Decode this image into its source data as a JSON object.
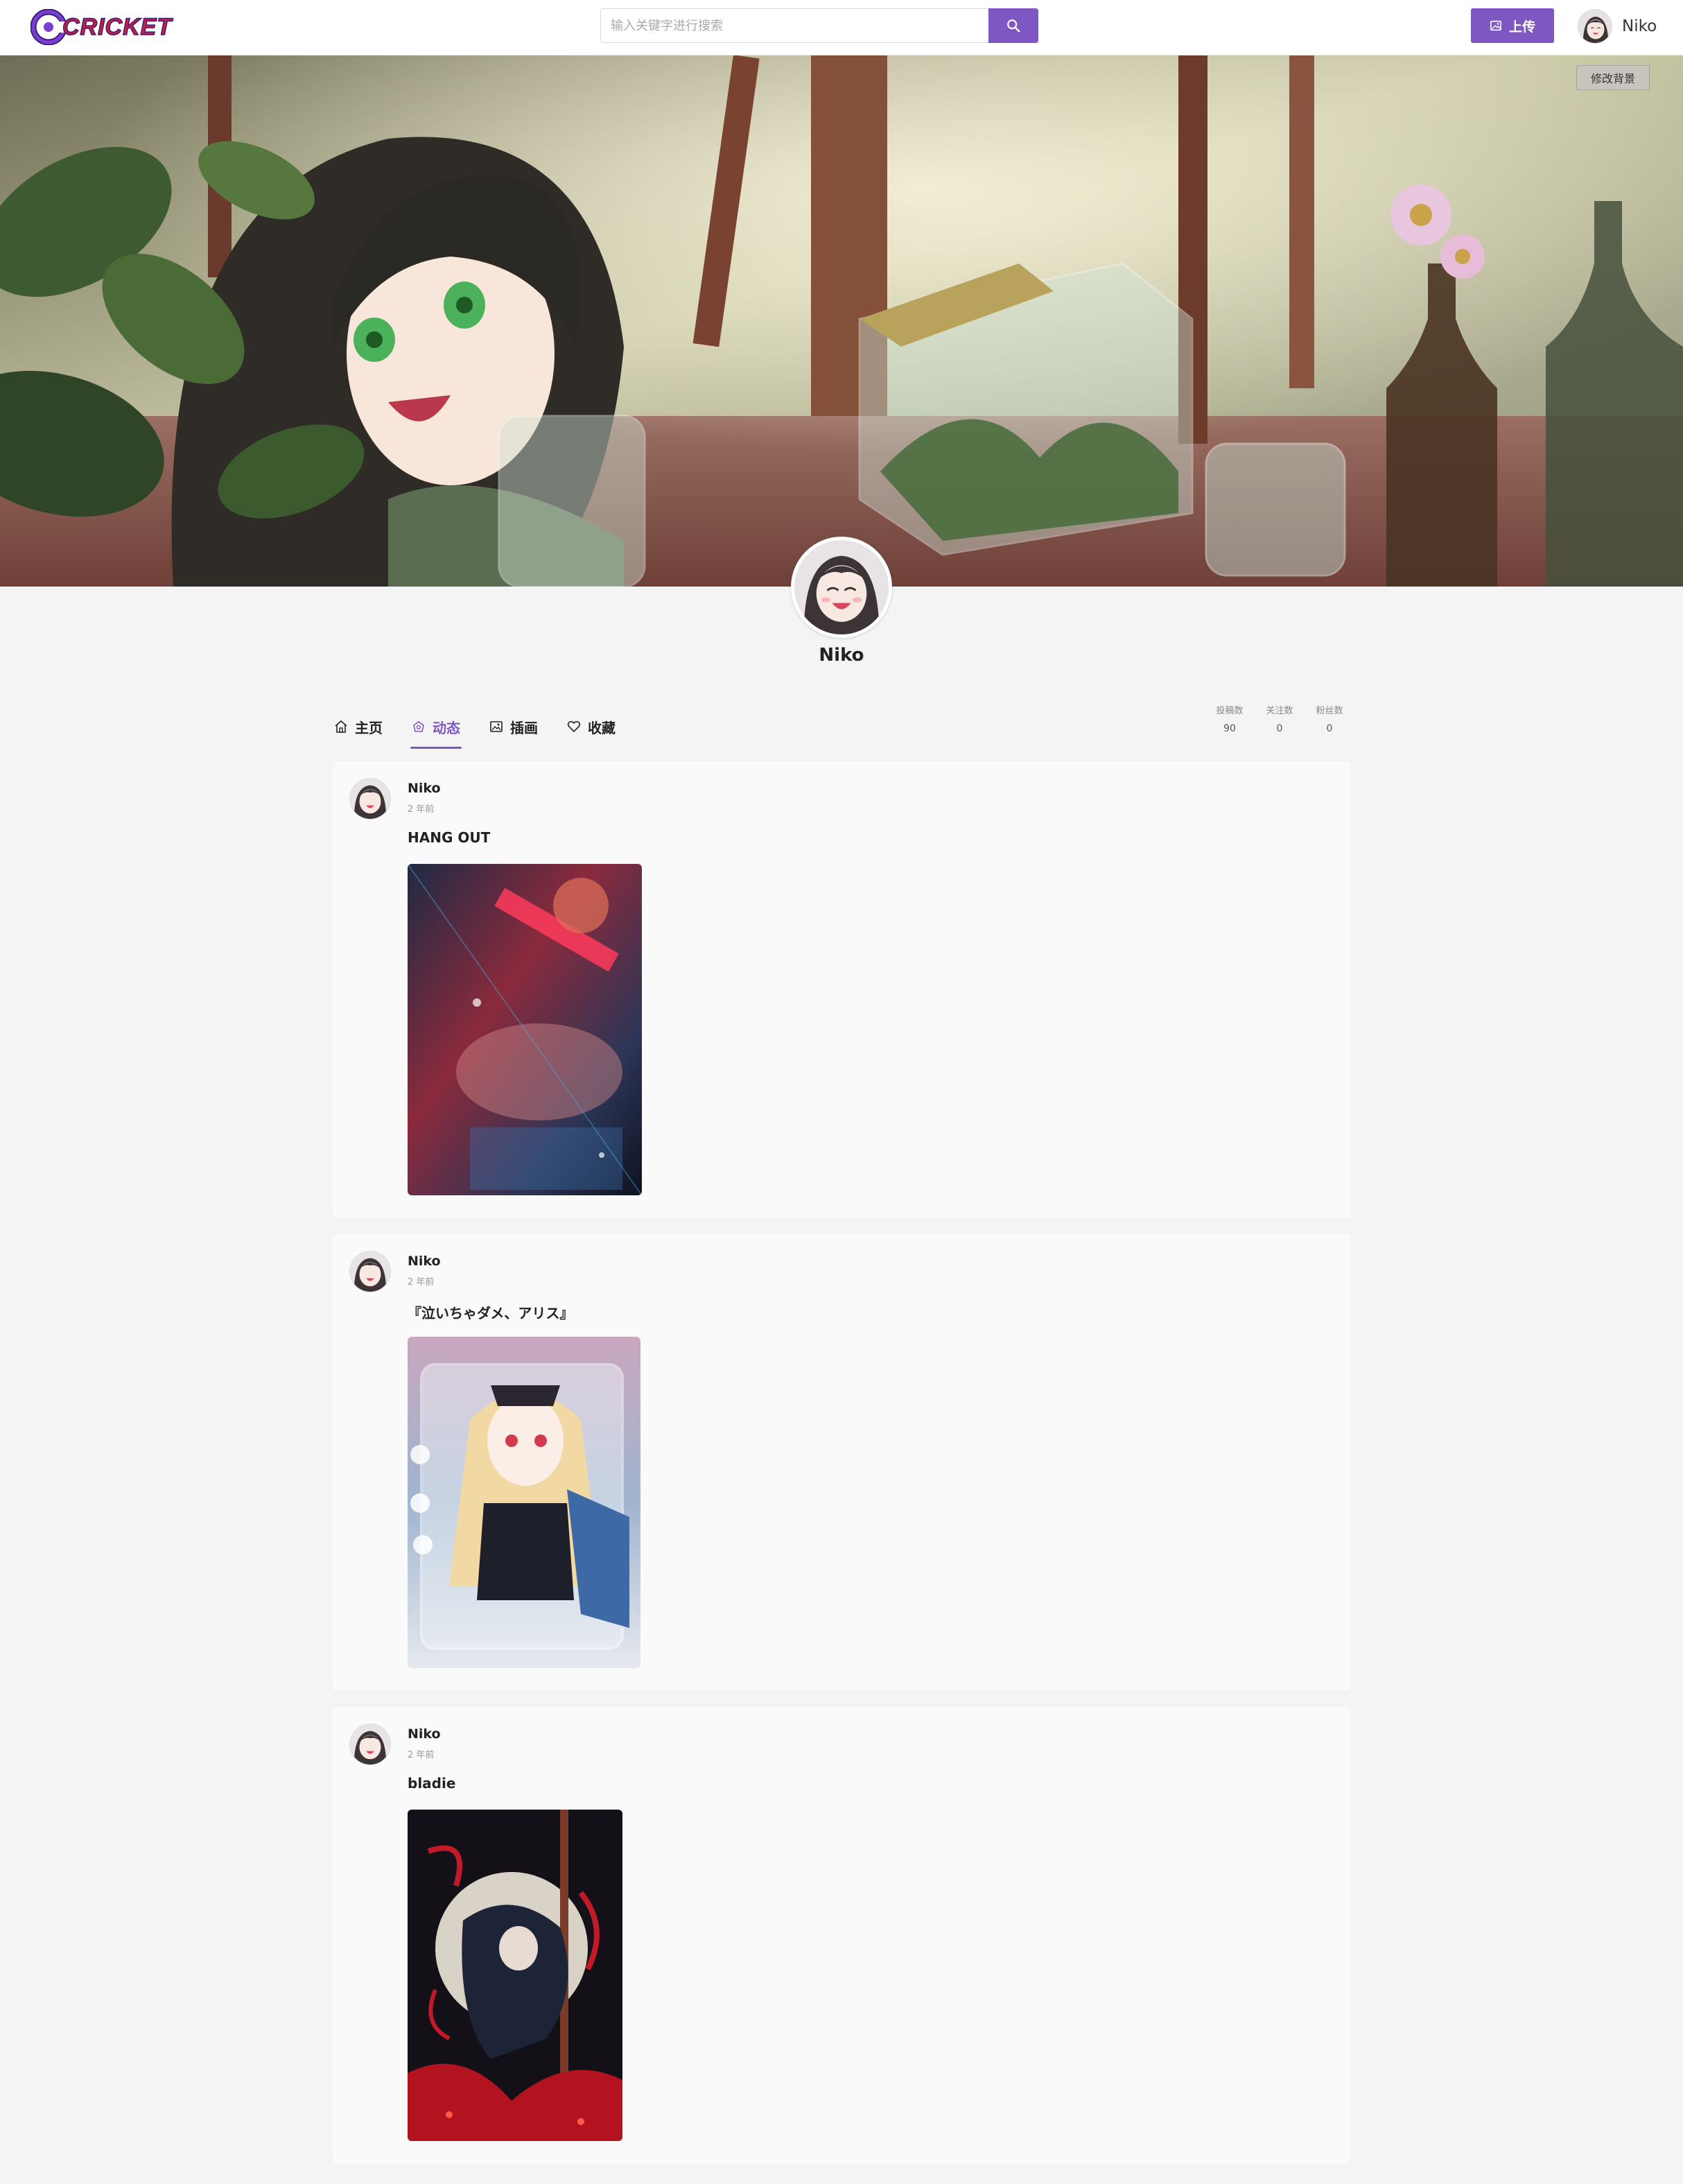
{
  "header": {
    "logo_text": "CRICKET",
    "search_placeholder": "输入关键字进行搜索",
    "upload_label": "上传",
    "user_name": "Niko"
  },
  "banner": {
    "edit_background_label": "修改背景"
  },
  "profile": {
    "name": "Niko"
  },
  "tabs": [
    {
      "label": "主页",
      "icon": "home-icon",
      "active": false
    },
    {
      "label": "动态",
      "icon": "activity-icon",
      "active": true
    },
    {
      "label": "插画",
      "icon": "image-icon",
      "active": false
    },
    {
      "label": "收藏",
      "icon": "heart-icon",
      "active": false
    }
  ],
  "stats": [
    {
      "label": "投稿数",
      "value": "90"
    },
    {
      "label": "关注数",
      "value": "0"
    },
    {
      "label": "粉丝数",
      "value": "0"
    }
  ],
  "posts": [
    {
      "author": "Niko",
      "time": "2 年前",
      "title": "HANG OUT"
    },
    {
      "author": "Niko",
      "time": "2 年前",
      "title": "『泣いちゃダメ、アリス』"
    },
    {
      "author": "Niko",
      "time": "2 年前",
      "title": "bladie"
    }
  ],
  "colors": {
    "accent": "#7e57c2",
    "page_background": "#f4f4f5",
    "card_background": "#fafafa"
  }
}
